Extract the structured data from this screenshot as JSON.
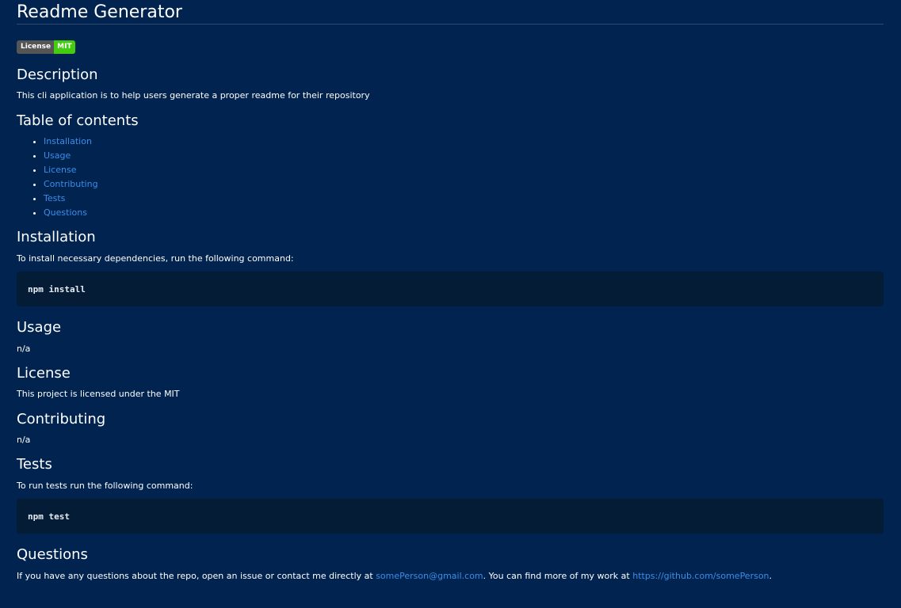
{
  "title": "Readme Generator",
  "badge": {
    "left": "License",
    "right": "MIT",
    "left_color": "#555555",
    "right_color": "#44cc11"
  },
  "description": {
    "heading": "Description",
    "text": "This cli application is to help users generate a proper readme for their repository"
  },
  "toc": {
    "heading": "Table of contents",
    "items": [
      {
        "label": "Installation"
      },
      {
        "label": "Usage"
      },
      {
        "label": "License"
      },
      {
        "label": "Contributing"
      },
      {
        "label": "Tests"
      },
      {
        "label": "Questions"
      }
    ]
  },
  "installation": {
    "heading": "Installation",
    "text": "To install necessary dependencies, run the following command:",
    "code": "npm install"
  },
  "usage": {
    "heading": "Usage",
    "text": "n/a"
  },
  "license": {
    "heading": "License",
    "text": "This project is licensed under the MIT"
  },
  "contributing": {
    "heading": "Contributing",
    "text": "n/a"
  },
  "tests": {
    "heading": "Tests",
    "text": "To run tests run the following command:",
    "code": "npm test"
  },
  "questions": {
    "heading": "Questions",
    "text_before": "If you have any questions about the repo, open an issue or contact me directly at ",
    "email": "somePerson@gmail.com",
    "text_middle": ". You can find more of my work at ",
    "github_url": "https://github.com/somePerson",
    "text_after": "."
  },
  "colors": {
    "background": "#00234f",
    "link": "#3b8eea",
    "code_background": "#041c36"
  }
}
